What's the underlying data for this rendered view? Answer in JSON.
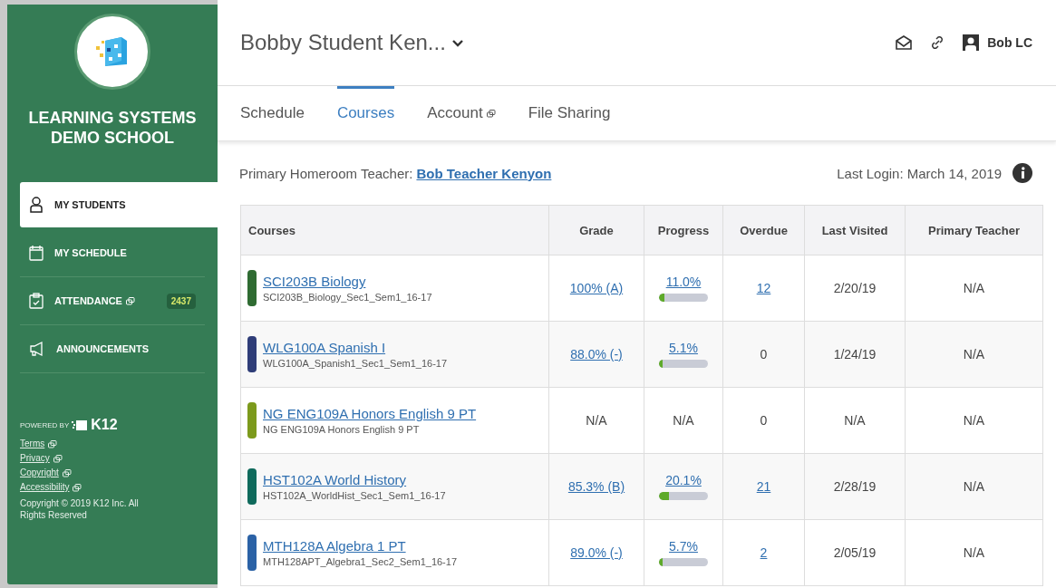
{
  "sidebar": {
    "school_name": "LEARNING SYSTEMS DEMO SCHOOL",
    "items": [
      {
        "label": "MY STUDENTS",
        "selected": true,
        "external": false
      },
      {
        "label": "MY SCHEDULE",
        "selected": false,
        "external": false
      },
      {
        "label": "ATTENDANCE",
        "selected": false,
        "external": true,
        "badge": "2437"
      },
      {
        "label": "ANNOUNCEMENTS",
        "selected": false,
        "external": false
      }
    ],
    "powered_by": "POWERED BY",
    "brand": "K12",
    "links": [
      "Terms",
      "Privacy",
      "Copyright",
      "Accessibility"
    ],
    "copyright": "Copyright © 2019 K12 Inc. All Rights Reserved"
  },
  "header": {
    "student_name": "Bobby Student Ken...",
    "user": "Bob LC"
  },
  "tabs": [
    {
      "label": "Schedule",
      "selected": false,
      "external": false
    },
    {
      "label": "Courses",
      "selected": true,
      "external": false
    },
    {
      "label": "Account",
      "selected": false,
      "external": true
    },
    {
      "label": "File Sharing",
      "selected": false,
      "external": false
    }
  ],
  "info": {
    "teacher_label": "Primary Homeroom Teacher:",
    "teacher": "Bob Teacher Kenyon",
    "last_login": "Last Login: March 14, 2019"
  },
  "table": {
    "columns": [
      "Courses",
      "Grade",
      "Progress",
      "Overdue",
      "Last Visited",
      "Primary Teacher"
    ],
    "rows": [
      {
        "color": "#2f6b32",
        "name": "SCI203B Biology",
        "section": "SCI203B_Biology_Sec1_Sem1_16-17",
        "grade": "100% (A)",
        "grade_linked": true,
        "progress": "11.0%",
        "level": 0.11,
        "overdue": "12",
        "overdue_linked": true,
        "last_visited": "2/20/19",
        "teacher": "N/A"
      },
      {
        "color": "#2f3d78",
        "name": "WLG100A Spanish I",
        "section": "WLG100A_Spanish1_Sec1_Sem1_16-17",
        "grade": "88.0% (-)",
        "grade_linked": true,
        "progress": "5.1%",
        "level": 0.051,
        "overdue": "0",
        "overdue_linked": false,
        "last_visited": "1/24/19",
        "teacher": "N/A"
      },
      {
        "color": "#7c9a1c",
        "name": "NG ENG109A Honors English 9 PT",
        "section": "NG ENG109A Honors English 9 PT",
        "grade": "N/A",
        "grade_linked": false,
        "progress": "N/A",
        "overdue": "0",
        "overdue_linked": false,
        "last_visited": "N/A",
        "teacher": "N/A"
      },
      {
        "color": "#0f6a5c",
        "name": "HST102A World History",
        "section": "HST102A_WorldHist_Sec1_Sem1_16-17",
        "grade": "85.3% (B)",
        "grade_linked": true,
        "progress": "20.1%",
        "level": 0.201,
        "overdue": "21",
        "overdue_linked": true,
        "last_visited": "2/28/19",
        "teacher": "N/A"
      },
      {
        "color": "#2b62a6",
        "name": "MTH128A Algebra 1 PT",
        "section": "MTH128APT_Algebra1_Sec2_Sem1_16-17",
        "grade": "89.0% (-)",
        "grade_linked": true,
        "progress": "5.7%",
        "level": 0.057,
        "overdue": "2",
        "overdue_linked": true,
        "last_visited": "2/05/19",
        "teacher": "N/A"
      }
    ]
  }
}
